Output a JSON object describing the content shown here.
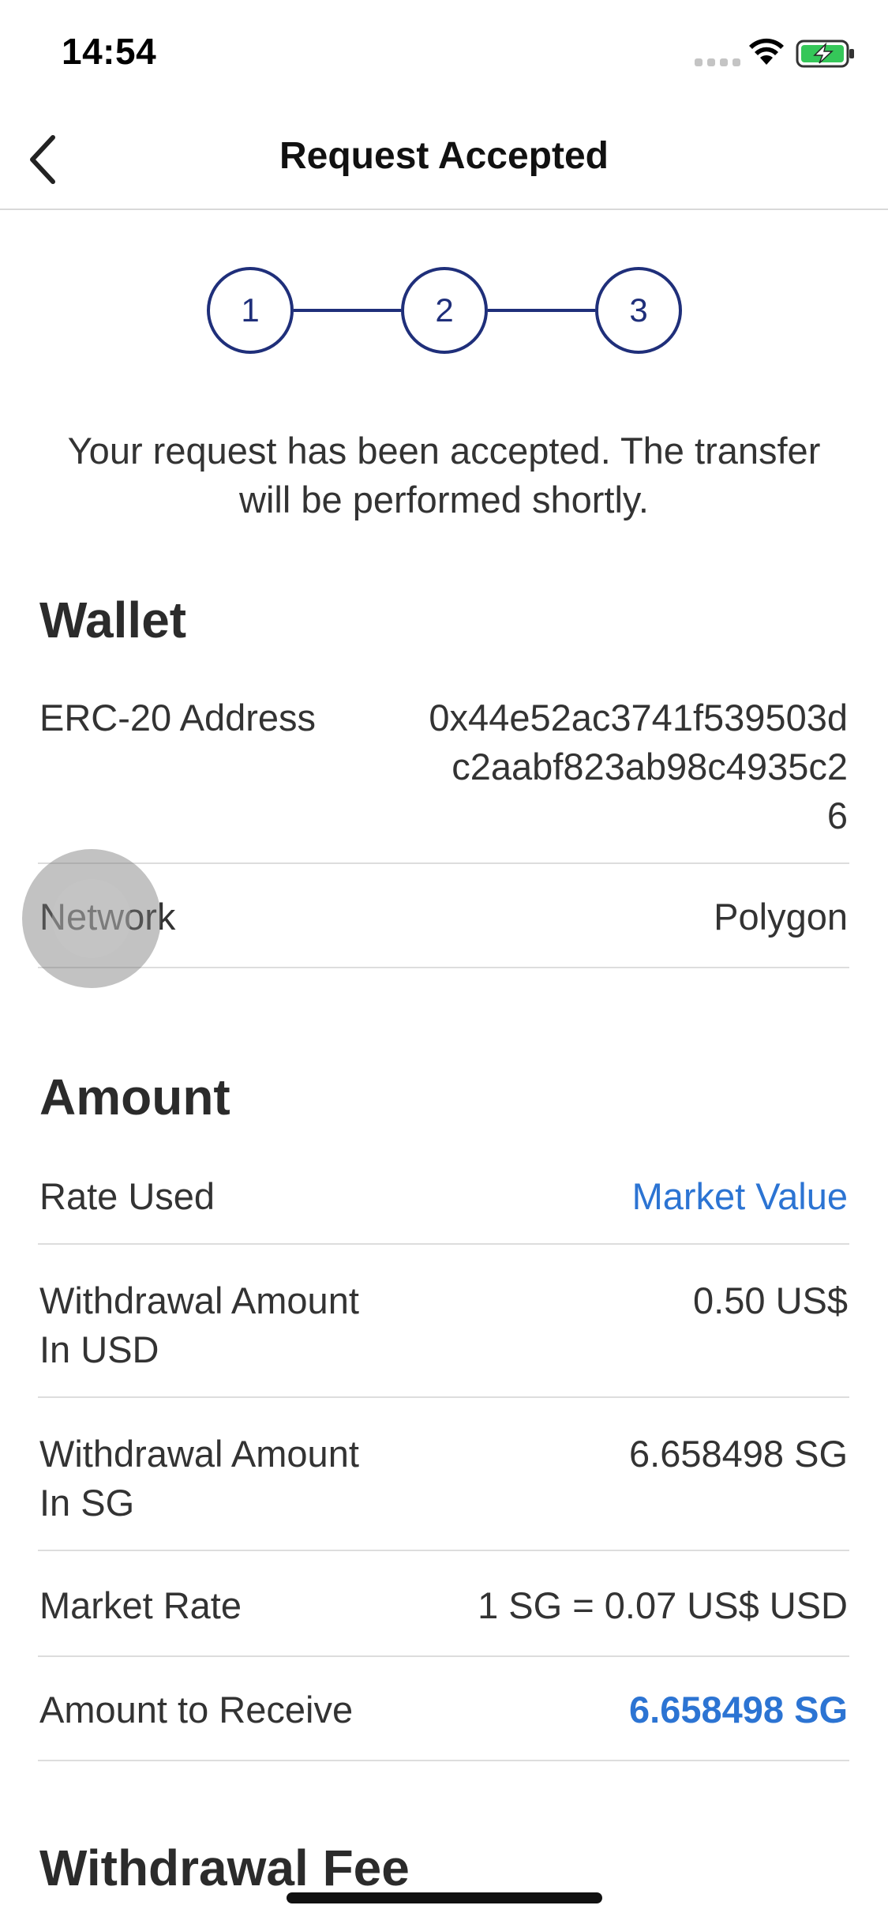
{
  "status_bar": {
    "time": "14:54"
  },
  "nav": {
    "title": "Request Accepted"
  },
  "stepper": {
    "steps": [
      "1",
      "2",
      "3"
    ]
  },
  "message": "Your request has been accepted. The transfer will be performed shortly.",
  "wallet": {
    "title": "Wallet",
    "rows": [
      {
        "label": "ERC-20 Address",
        "value_lines": [
          "0x44e52ac3741f539503d",
          "c2aabf823ab98c4935c2",
          "6"
        ]
      },
      {
        "label": "Network",
        "value": "Polygon"
      }
    ]
  },
  "amount": {
    "title": "Amount",
    "rows": [
      {
        "label": "Rate Used",
        "value": "Market Value"
      },
      {
        "label_lines": [
          "Withdrawal Amount",
          "In USD"
        ],
        "value": "0.50 US$"
      },
      {
        "label_lines": [
          "Withdrawal Amount",
          "In SG"
        ],
        "value": "6.658498 SG"
      },
      {
        "label": "Market Rate",
        "value": "1 SG = 0.07 US$ USD"
      },
      {
        "label": "Amount to Receive",
        "value": "6.658498 SG"
      }
    ]
  },
  "fee": {
    "title": "Withdrawal Fee"
  },
  "colors": {
    "accent": "#2c74d3",
    "stepper": "#1f2f7a",
    "battery": "#35c759"
  }
}
